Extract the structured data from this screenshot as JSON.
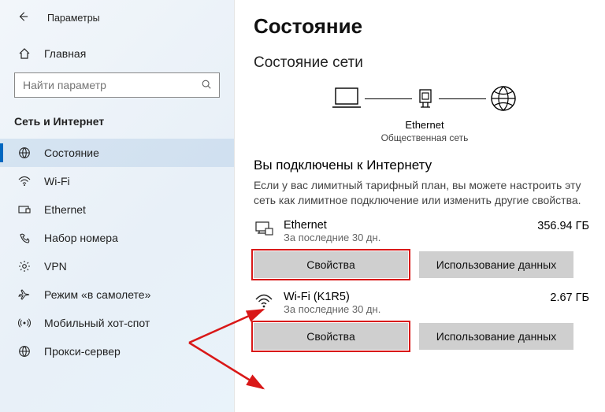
{
  "titlebar": {
    "title": "Параметры"
  },
  "home": {
    "label": "Главная"
  },
  "search": {
    "placeholder": "Найти параметр"
  },
  "section": {
    "title": "Сеть и Интернет"
  },
  "nav": {
    "items": [
      {
        "label": "Состояние"
      },
      {
        "label": "Wi-Fi"
      },
      {
        "label": "Ethernet"
      },
      {
        "label": "Набор номера"
      },
      {
        "label": "VPN"
      },
      {
        "label": "Режим «в самолете»"
      },
      {
        "label": "Мобильный хот-спот"
      },
      {
        "label": "Прокси-сервер"
      }
    ]
  },
  "main": {
    "heading": "Состояние",
    "subheading": "Состояние сети",
    "diagram": {
      "label": "Ethernet",
      "sublabel": "Общественная сеть"
    },
    "connected_title": "Вы подключены к Интернету",
    "connected_desc": "Если у вас лимитный тарифный план, вы можете настроить эту сеть как лимитное подключение или изменить другие свойства.",
    "connections": [
      {
        "name": "Ethernet",
        "sub": "За последние 30 дн.",
        "usage": "356.94 ГБ",
        "props_label": "Свойства",
        "usage_label": "Использование данных"
      },
      {
        "name": "Wi-Fi (K1R5)",
        "sub": "За последние 30 дн.",
        "usage": "2.67 ГБ",
        "props_label": "Свойства",
        "usage_label": "Использование данных"
      }
    ]
  }
}
